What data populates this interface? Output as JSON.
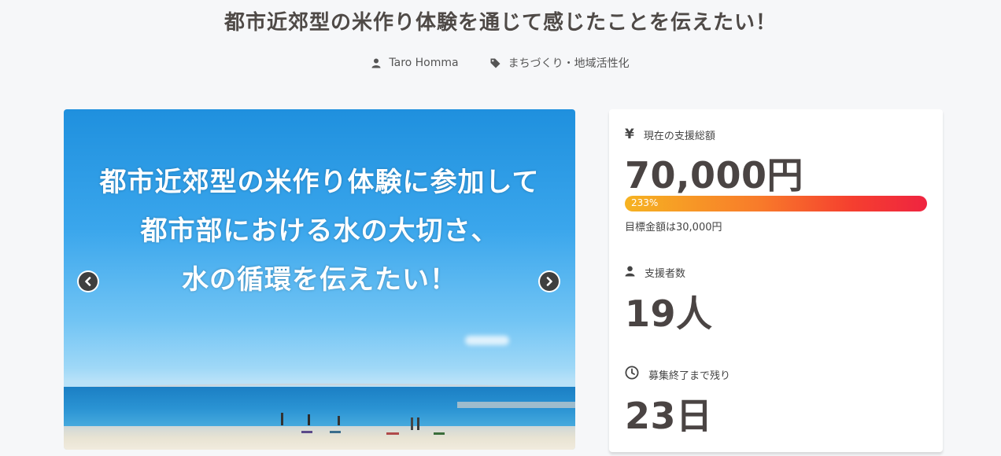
{
  "project": {
    "title": "都市近郊型の米作り体験を通じて感じたことを伝えたい！",
    "author": "Taro Homma",
    "category": "まちづくり・地域活性化"
  },
  "hero": {
    "caption_lines": [
      "都市近郊型の米作り体験に参加して",
      "都市部における水の大切さ、",
      "水の循環を伝えたい！"
    ]
  },
  "icons": {
    "author": "user-icon",
    "category": "tag-icon",
    "prev": "chevron-left-circle-icon",
    "next": "chevron-right-circle-icon",
    "yen": "yen-icon",
    "backers": "user-icon",
    "clock": "clock-icon"
  },
  "stats": {
    "total_label": "現在の支援総額",
    "total_value": "70,000円",
    "progress_text": "233%",
    "progress_percent": 233,
    "goal_text": "目標金額は30,000円",
    "backers_label": "支援者数",
    "backers_value": "19人",
    "remaining_label": "募集終了まで残り",
    "remaining_value": "23日"
  },
  "colors": {
    "title": "#4f4a47",
    "progress_start": "#f6b322",
    "progress_end": "#ef2440",
    "sky": "#2f9fe8"
  }
}
